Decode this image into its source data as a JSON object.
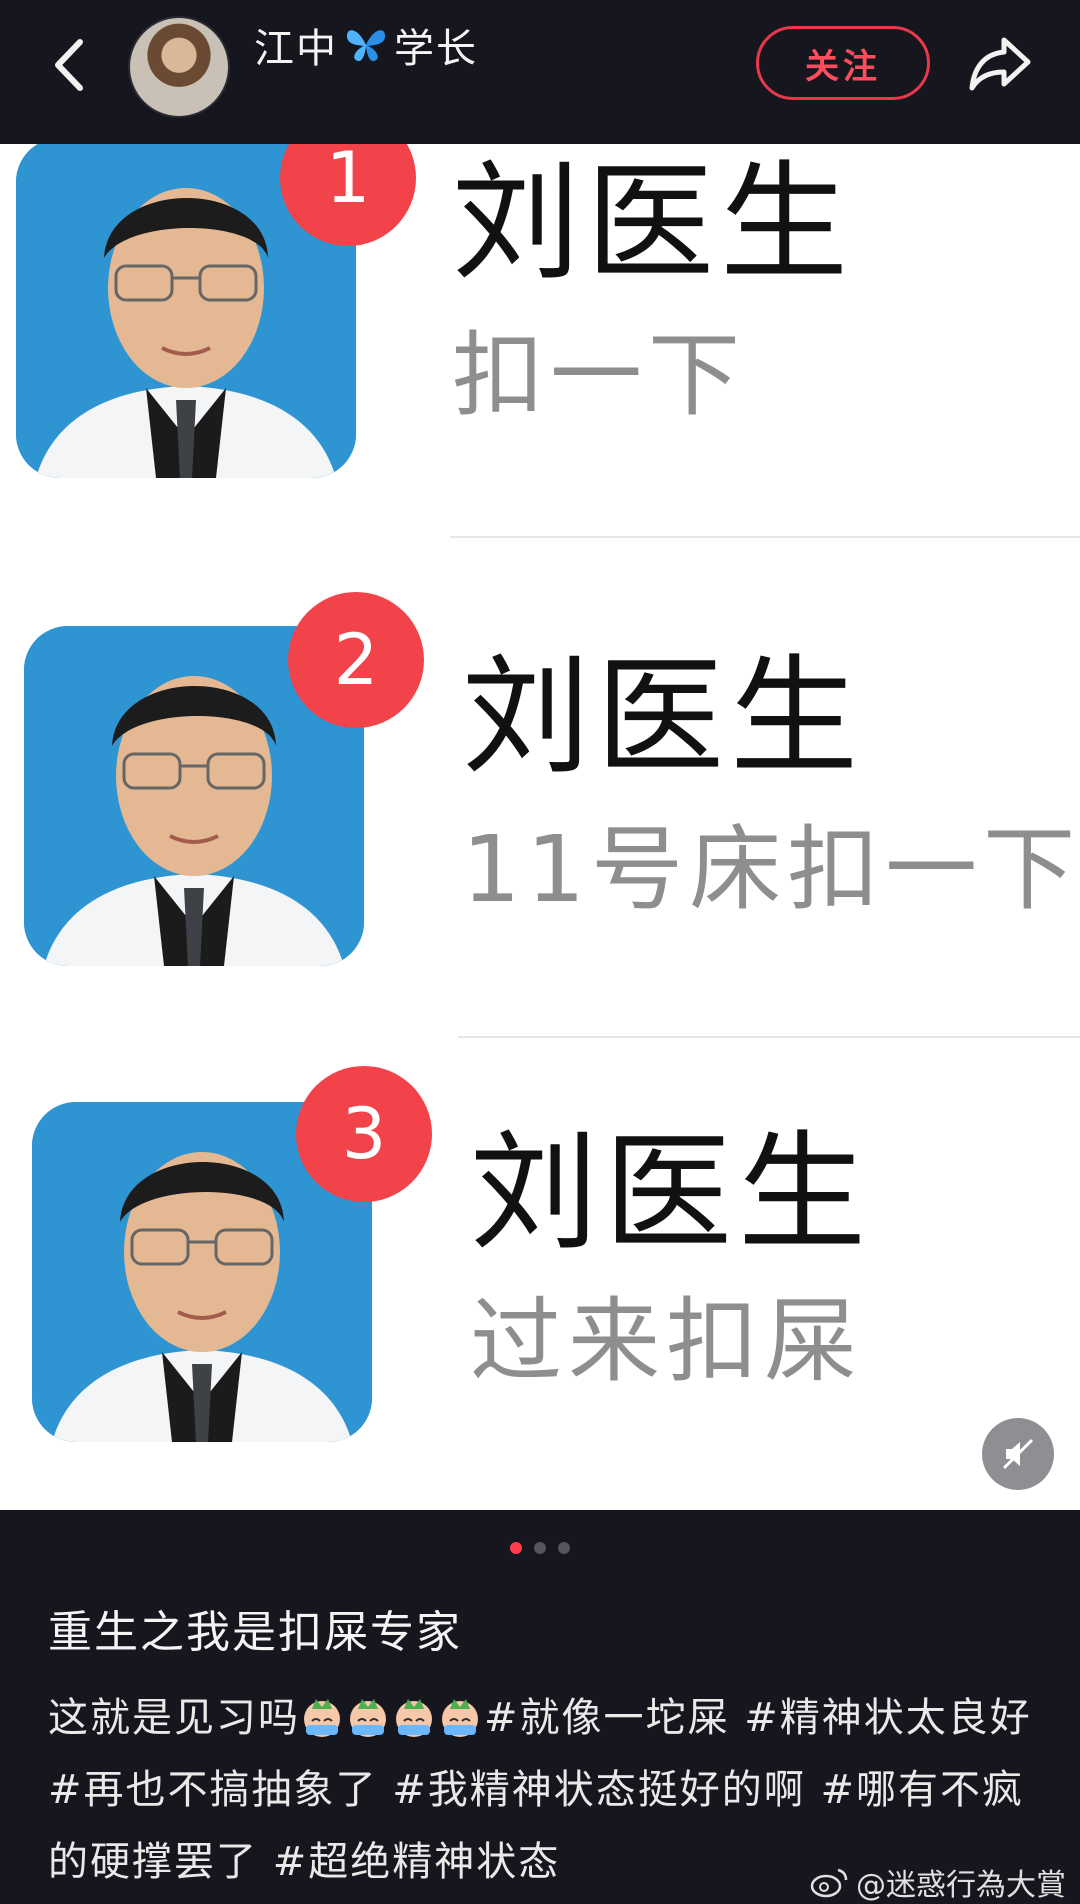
{
  "header": {
    "username_left": "江中",
    "username_right": "学长",
    "follow_label": "关注"
  },
  "image": {
    "rows": [
      {
        "badge": "1",
        "name": "刘医生",
        "message": "扣一下"
      },
      {
        "badge": "2",
        "name": "刘医生",
        "message": "11号床扣一下"
      },
      {
        "badge": "3",
        "name": "刘医生",
        "message": "过来扣屎"
      }
    ]
  },
  "carousel": {
    "total": 3,
    "active": 0
  },
  "post": {
    "title": "重生之我是扣屎专家",
    "body_prefix": "这就是见习吗",
    "body_rest": "#就像一坨屎 #精神状太良好 #再也不搞抽象了 #我精神状态挺好的啊 #哪有不疯的硬撑罢了 #超绝精神状态"
  },
  "watermark": "@迷惑行為大賞",
  "colors": {
    "accent": "#ff3c4c",
    "background": "#16161e",
    "badge": "#f2424a",
    "photo_bg": "#2f94d2"
  }
}
